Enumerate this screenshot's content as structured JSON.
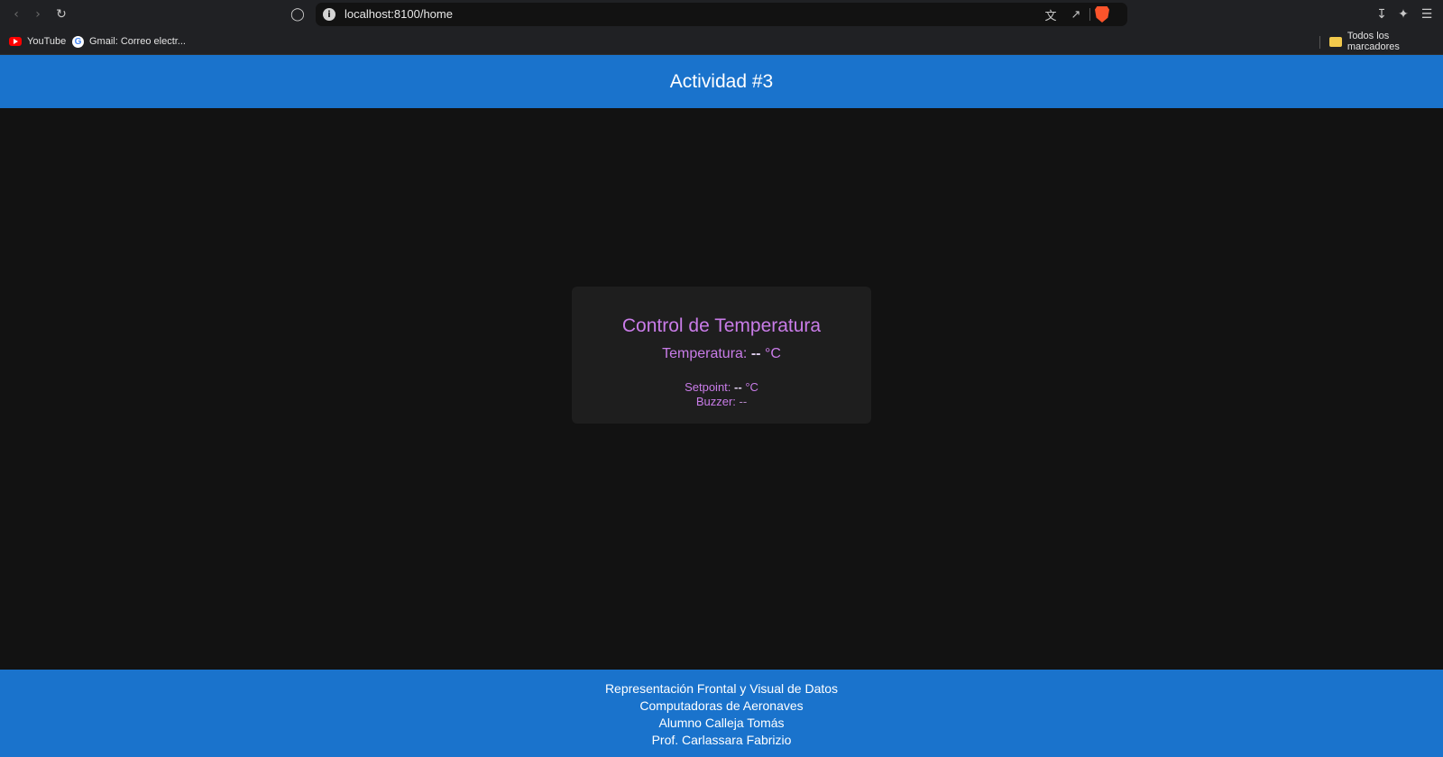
{
  "browser": {
    "url": "localhost:8100/home",
    "bookmarks": [
      {
        "label": "YouTube",
        "icon": "youtube-icon"
      },
      {
        "label": "Gmail: Correo electr...",
        "icon": "google-icon"
      }
    ],
    "all_bookmarks_label": "Todos los marcadores"
  },
  "header": {
    "title": "Actividad #3"
  },
  "card": {
    "title": "Control de Temperatura",
    "temperature": {
      "label": "Temperatura:",
      "value": "--",
      "unit": "°C"
    },
    "setpoint": {
      "label": "Setpoint:",
      "value": "--",
      "unit": "°C"
    },
    "buzzer": {
      "label": "Buzzer:",
      "value": "--"
    }
  },
  "footer": {
    "lines": [
      "Representación Frontal y Visual de Datos",
      "Computadoras de Aeronaves",
      "Alumno Calleja Tomás",
      "Prof. Carlassara Fabrizio"
    ]
  },
  "colors": {
    "primary": "#1a73cc",
    "background": "#121212",
    "card": "#1e1e1e",
    "accent_text": "#c97ce8"
  }
}
